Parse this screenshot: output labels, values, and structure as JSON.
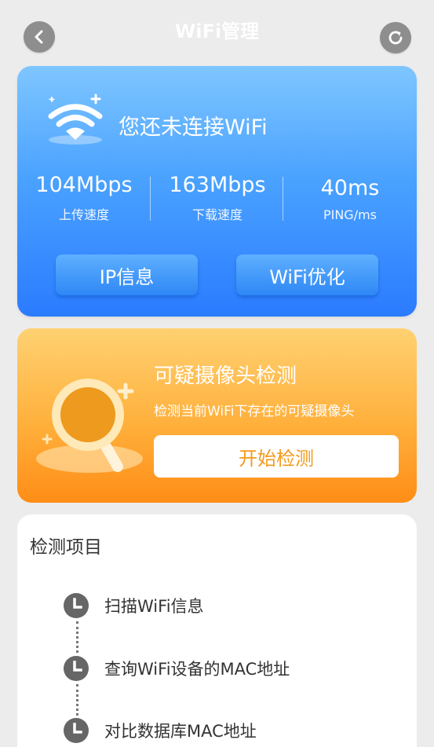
{
  "header": {
    "title": "WiFi管理",
    "back_icon": "chevron-left-icon",
    "refresh_icon": "refresh-icon"
  },
  "wifi_card": {
    "status": "您还未连接WiFi",
    "stats": [
      {
        "value": "104Mbps",
        "label": "上传速度"
      },
      {
        "value": "163Mbps",
        "label": "下载速度"
      },
      {
        "value": "40ms",
        "label": "PING/ms"
      }
    ],
    "buttons": {
      "ip_info": "IP信息",
      "wifi_optimize": "WiFi优化"
    },
    "colors": {
      "top": "#7fc6ff",
      "bottom": "#2b7bff"
    }
  },
  "camera_card": {
    "title": "可疑摄像头检测",
    "description": "检测当前WiFi下存在的可疑摄像头",
    "start_button": "开始检测",
    "colors": {
      "top": "#ffd172",
      "bottom": "#ff8d16",
      "button_text": "#f39a1c"
    }
  },
  "items_card": {
    "title": "检测项目",
    "steps": [
      {
        "label": "扫描WiFi信息",
        "icon": "clock-icon"
      },
      {
        "label": "查询WiFi设备的MAC地址",
        "icon": "clock-icon"
      },
      {
        "label": "对比数据库MAC地址",
        "icon": "clock-icon"
      }
    ]
  }
}
